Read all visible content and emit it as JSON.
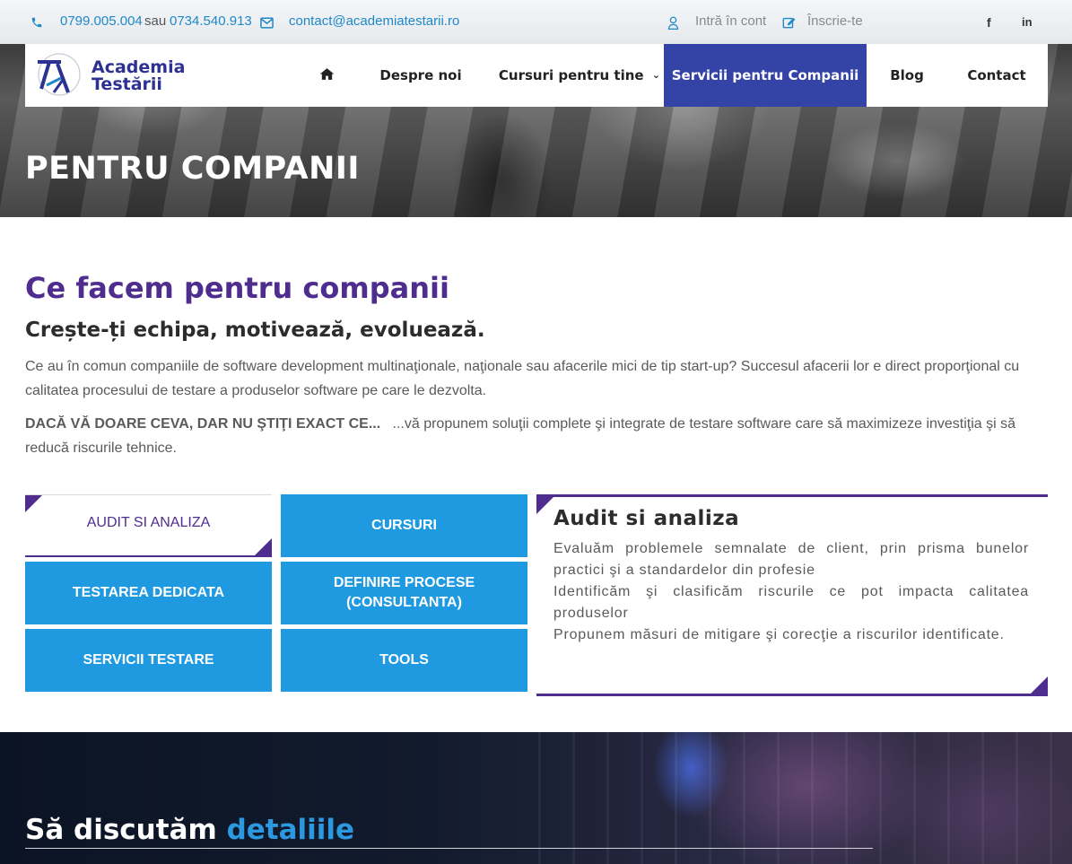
{
  "topbar": {
    "phone1": "0799.005.004",
    "sep": "sau",
    "phone2": "0734.540.913",
    "email": "contact@academiatestarii.ro",
    "login": "Intră în cont",
    "signup": "Înscrie-te",
    "social": [
      "facebook-icon",
      "linkedin-icon"
    ],
    "facebook_glyph": "f",
    "linkedin_glyph": "in"
  },
  "logo": {
    "line1": "Academia",
    "line2": "Testării"
  },
  "nav": {
    "home_icon": "home-icon",
    "items": [
      "Despre noi",
      "Cursuri pentru tine",
      "Servicii pentru Companii",
      "Blog",
      "Contact"
    ],
    "dropdown_glyph": "⌄",
    "active_index": 2
  },
  "hero": {
    "title": "PENTRU COMPANII"
  },
  "intro": {
    "heading": "Ce facem pentru companii",
    "subheading": "Crește-ți echipa, motivează, evoluează.",
    "para1": "Ce au în comun companiile de software development multinaţionale, naţionale sau afacerile mici de tip start-up? Succesul afacerii lor e direct proporţional cu calitatea procesului de testare a produselor software pe care le dezvolta.",
    "para2_strong": "DACĂ VĂ DOARE CEVA, DAR NU ŞTIŢI EXACT CE...",
    "para2_rest": "...vă propunem soluţii complete şi integrate de testare software care să maximizeze investiţia şi să reducă riscurile tehnice."
  },
  "tiles": [
    "AUDIT SI ANALIZA",
    "CURSURI",
    "TESTAREA DEDICATA",
    "DEFINIRE PROCESE (CONSULTANTA)",
    "SERVICII TESTARE",
    "TOOLS"
  ],
  "active_tile": 0,
  "panel": {
    "title": "Audit si analiza",
    "lines": [
      "Evaluăm problemele semnalate de client, prin prisma bunelor practici şi a standardelor din profesie",
      "Identificăm şi clasificăm riscurile ce pot impacta calitatea produselor",
      "Propunem măsuri de mitigare şi corecţie a riscurilor identificate."
    ]
  },
  "discuss": {
    "title_plain": "Să discutăm",
    "title_accent": "detaliile"
  },
  "colors": {
    "purple": "#4f2d8f",
    "blue": "#1f9ae0",
    "nav_active": "#3443a6",
    "link": "#1e88c9"
  }
}
